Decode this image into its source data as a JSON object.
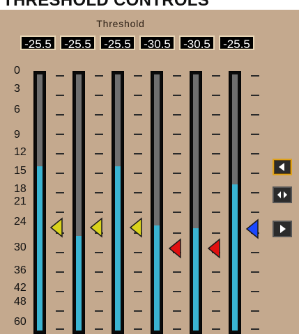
{
  "header": {
    "title": "THRESHOLD CONTROLS"
  },
  "threshold_panel": {
    "label": "Threshold",
    "values": [
      "-25.5",
      "-25.5",
      "-25.5",
      "-30.5",
      "-30.5",
      "-25.5"
    ]
  },
  "scale": {
    "labels": [
      "0",
      "3",
      "6",
      "9",
      "12",
      "15",
      "18",
      "21",
      "24",
      "30",
      "36",
      "42",
      "48",
      "60"
    ]
  },
  "meters": {
    "count": 6,
    "level_fraction": [
      0.64,
      0.37,
      0.64,
      0.41,
      0.4,
      0.57
    ]
  },
  "markers": {
    "colors": [
      "#d9d21b",
      "#d9d21b",
      "#d9d21b",
      "#e01010",
      "#e01010",
      "#1947ff"
    ],
    "names": [
      "yellow",
      "yellow",
      "yellow",
      "red",
      "red",
      "blue"
    ]
  },
  "side_controls": {
    "icons": [
      "arrow-left-icon",
      "arrow-left-right-icon",
      "arrow-right-icon"
    ],
    "active_index": 0
  }
}
